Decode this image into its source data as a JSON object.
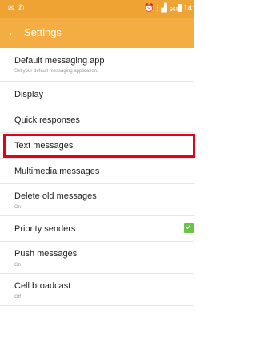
{
  "status_bar": {
    "icons": [
      "mail-icon",
      "phone-icon",
      "alarm-icon",
      "vibrate-icon",
      "signal-icon",
      "battery-icon"
    ],
    "battery_pct": "96%",
    "time": "14:"
  },
  "app_bar": {
    "back_glyph": "←",
    "title": "Settings"
  },
  "settings": {
    "items": [
      {
        "label": "Default messaging app",
        "sub": "Set your default messaging application."
      },
      {
        "label": "Display"
      },
      {
        "label": "Quick responses"
      },
      {
        "label": "Text messages"
      },
      {
        "label": "Multimedia messages"
      },
      {
        "label": "Delete old messages",
        "sub": "On"
      },
      {
        "label": "Priority senders",
        "checked": true
      },
      {
        "label": "Push messages",
        "sub": "On"
      },
      {
        "label": "Cell broadcast",
        "sub": "Off"
      }
    ]
  },
  "colors": {
    "status_bar": "#efa332",
    "app_bar": "#f4ad42",
    "highlight": "#e2001a",
    "checkbox": "#6cc24a"
  }
}
